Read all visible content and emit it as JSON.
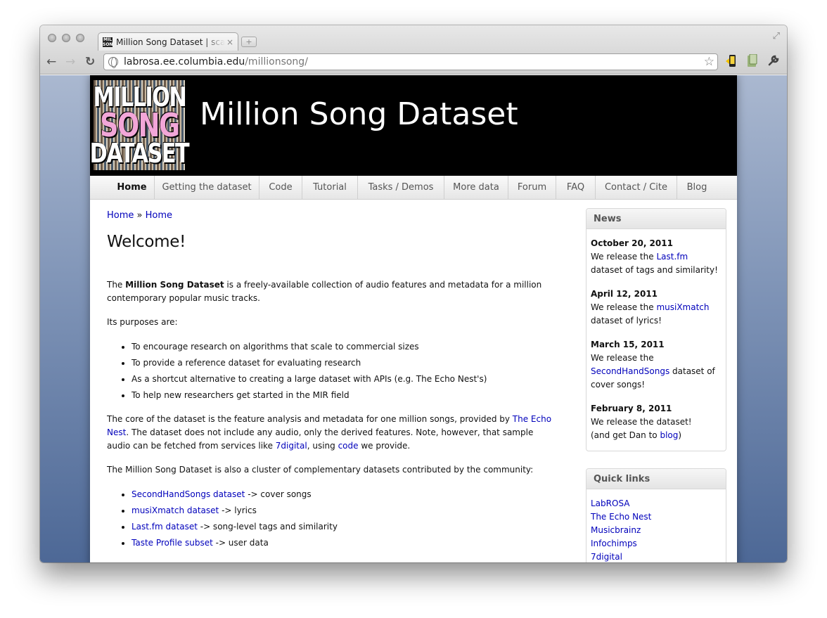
{
  "browser": {
    "tab_title": "Million Song Dataset | scaling MIR research",
    "tab_close": "×",
    "new_tab": "+",
    "favicon_text": "MIL SON DAT",
    "url_host": "labrosa.ee.columbia.edu",
    "url_path": "/millionsong/",
    "back": "←",
    "forward": "→",
    "reload": "↻",
    "star": "☆",
    "wrench": "🔧"
  },
  "site": {
    "logo_lines": [
      "MILLION",
      "SONG",
      "DATASET"
    ],
    "title": "Million Song Dataset"
  },
  "menu": [
    {
      "label": "Home"
    },
    {
      "label": "Getting the dataset"
    },
    {
      "label": "Code"
    },
    {
      "label": "Tutorial"
    },
    {
      "label": "Tasks / Demos"
    },
    {
      "label": "More data"
    },
    {
      "label": "Forum"
    },
    {
      "label": "FAQ"
    },
    {
      "label": "Contact / Cite"
    },
    {
      "label": "Blog"
    }
  ],
  "breadcrumb": {
    "first": "Home",
    "sep": " » ",
    "second": "Home"
  },
  "main": {
    "heading": "Welcome!",
    "intro_pre": "The ",
    "intro_bold": "Million Song Dataset",
    "intro_post": " is a freely-available collection of audio features and metadata for a million contemporary popular music tracks.",
    "purposes_label": "Its purposes are:",
    "purposes": [
      "To encourage research on algorithms that scale to commercial sizes",
      "To provide a reference dataset for evaluating research",
      "As a shortcut alternative to creating a large dataset with APIs (e.g. The Echo Nest's)",
      "To help new researchers get started in the MIR field"
    ],
    "core_1": "The core of the dataset is the feature analysis and metadata for one million songs, provided by ",
    "core_link_echonest": "The Echo Nest",
    "core_2": ". The dataset does not include any audio, only the derived features. Note, however, that sample audio can be fetched from services like ",
    "core_link_7digital": "7digital",
    "core_3": ", using ",
    "core_link_code": "code",
    "core_4": " we provide.",
    "cluster_text": "The Million Song Dataset is also a cluster of complementary datasets contributed by the community:",
    "datasets": [
      {
        "link": "SecondHandSongs dataset",
        "desc": " -> cover songs"
      },
      {
        "link": "musiXmatch dataset",
        "desc": " -> lyrics"
      },
      {
        "link": "Last.fm dataset",
        "desc": " -> song-level tags and similarity"
      },
      {
        "link": "Taste Profile subset",
        "desc": " -> user data"
      }
    ]
  },
  "news": {
    "title": "News",
    "items": [
      {
        "date": "October 20, 2011",
        "pre": "We release the ",
        "link": "Last.fm",
        "post": " dataset of tags and similarity!"
      },
      {
        "date": "April 12, 2011",
        "pre": "We release the ",
        "link": "musiXmatch",
        "post": " dataset of lyrics!"
      },
      {
        "date": "March 15, 2011",
        "pre": "We release the ",
        "link": "SecondHandSongs",
        "post": " dataset of cover songs!"
      },
      {
        "date": "February 8, 2011",
        "pre": "We release the dataset!",
        "pre2": "(and get Dan to ",
        "link": "blog",
        "post": ")"
      }
    ]
  },
  "quick_links": {
    "title": "Quick links",
    "items": [
      "LabROSA",
      "The Echo Nest",
      "Musicbrainz",
      "Infochimps",
      "7digital"
    ]
  }
}
